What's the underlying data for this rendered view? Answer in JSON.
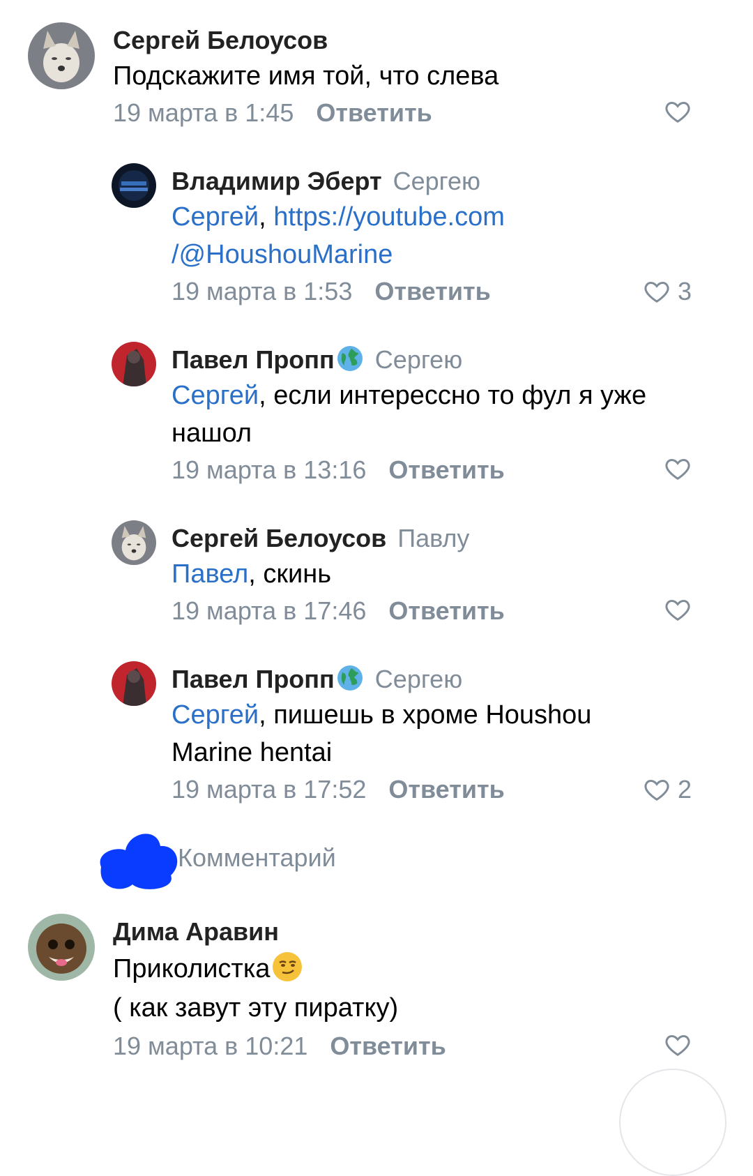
{
  "comments": [
    {
      "author": "Сергей Белоусов",
      "reply_to": "",
      "mention": "",
      "text_lines": [
        "Подскажите имя той, что слева"
      ],
      "date": "19 марта в 1:45",
      "reply_label": "Ответить",
      "likes": "",
      "avatar": "wolf-avatar"
    },
    {
      "author": "Владимир Эберт",
      "reply_to": "Сергею",
      "mention": "Сергей",
      "text_lines": [
        "https://youtube.com",
        "/@HoushouMarine"
      ],
      "date": "19 марта в 1:53",
      "reply_label": "Ответить",
      "likes": "3",
      "avatar": "dark-avatar"
    },
    {
      "author": "Павел Пропп",
      "reply_to": "Сергею",
      "mention": "Сергей",
      "text_lines": [
        ", если интерессно то фул я уже",
        "нашол"
      ],
      "date": "19 марта в 13:16",
      "reply_label": "Ответить",
      "likes": "",
      "avatar": "red-avatar"
    },
    {
      "author": "Сергей Белоусов",
      "reply_to": "Павлу",
      "mention": "Павел",
      "text_lines": [
        ", скинь"
      ],
      "date": "19 марта в 17:46",
      "reply_label": "Ответить",
      "likes": "",
      "avatar": "wolf-avatar"
    },
    {
      "author": "Павел Пропп",
      "reply_to": "Сергею",
      "mention": "Сергей",
      "text_lines": [
        ", пишешь в хроме Houshou",
        "Marine hentai"
      ],
      "date": "19 марта в 17:52",
      "reply_label": "Ответить",
      "likes": "2",
      "avatar": "red-avatar"
    },
    {
      "author": "Дима Аравин",
      "reply_to": "",
      "mention": "",
      "text_lines": [
        "Приколистка",
        "( как завут эту пиратку)"
      ],
      "date": "19 марта в 10:21",
      "reply_label": "Ответить",
      "likes": "",
      "avatar": "sackboy-avatar"
    }
  ],
  "reply_input": {
    "placeholder": "Комментарий"
  },
  "colors": {
    "link": "#2a70c8",
    "secondary": "#818c99",
    "scribble": "#0a3cff"
  },
  "icons": [
    "heart-icon",
    "globe-icon",
    "smirk-emoji-icon"
  ]
}
